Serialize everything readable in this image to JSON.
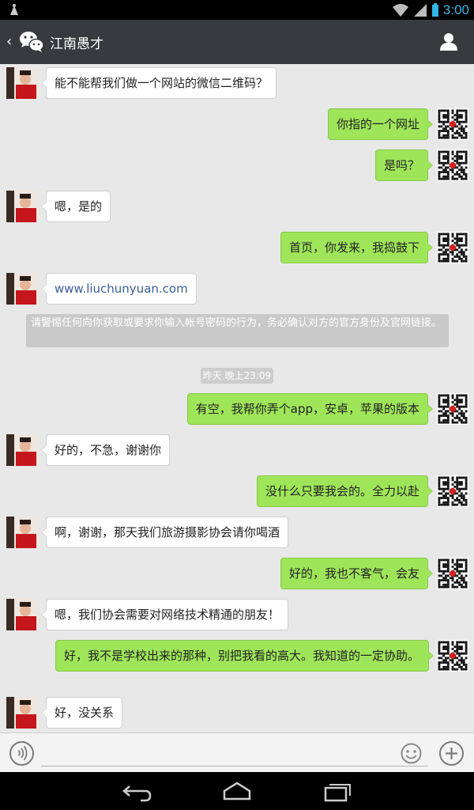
{
  "statusbar": {
    "time": "3:00"
  },
  "header": {
    "title": "江南愚才"
  },
  "messages": [
    {
      "dir": "in",
      "text": "能不能帮我们做一个网站的微信二维码？"
    },
    {
      "dir": "out",
      "text": "你指的一个网址"
    },
    {
      "dir": "out",
      "text": "是吗？"
    },
    {
      "dir": "in",
      "text": "嗯，是的"
    },
    {
      "dir": "out",
      "text": "首页，你发来，我捣鼓下"
    },
    {
      "dir": "in",
      "text": "www.liuchunyuan.com"
    },
    {
      "dir": "out",
      "text": "有空，我帮你弄个app，安卓，苹果的版本"
    },
    {
      "dir": "in",
      "text": "好的，不急，谢谢你"
    },
    {
      "dir": "out",
      "text": "没什么只要我会的。全力以赴"
    },
    {
      "dir": "in",
      "text": "啊，谢谢，那天我们旅游摄影协会请你喝酒"
    },
    {
      "dir": "out",
      "text": "好的，我也不客气，会友"
    },
    {
      "dir": "in",
      "text": "嗯，我们协会需要对网络技术精通的朋友！"
    },
    {
      "dir": "out",
      "text": "好，我不是学校出来的那种，别把我看的高大。我知道的一定协助。"
    },
    {
      "dir": "in",
      "text": "好，没关系"
    }
  ],
  "system_notice": "请警惕任何向你获取或要求你输入帐号密码的行为，务必确认对方的官方身份及官网链接。",
  "timestamp": "昨天 晚上23:09",
  "input": {
    "placeholder": ""
  },
  "colors": {
    "out_bubble": "#9fe55a",
    "header_bg": "#393a3f",
    "status_accent": "#33b5e5"
  }
}
